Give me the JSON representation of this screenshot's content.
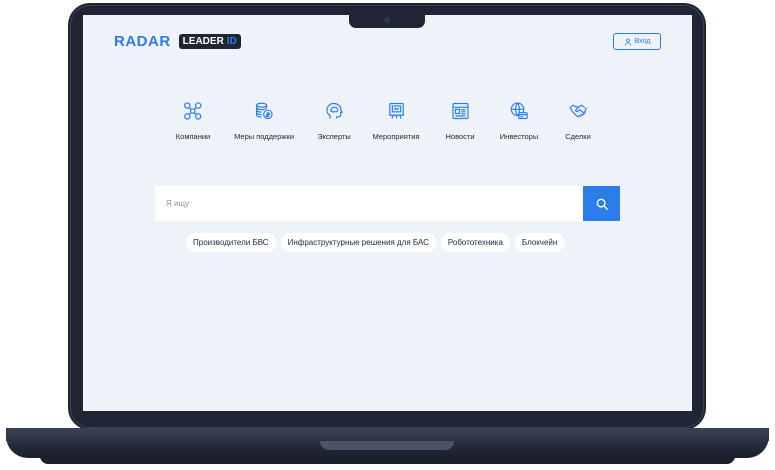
{
  "header": {
    "logo_text": "RADAR",
    "logo_badge_main": "LEADER",
    "logo_badge_accent": "ID",
    "login_label": "Вход"
  },
  "categories": [
    {
      "label": "Компании",
      "icon": "drone-icon"
    },
    {
      "label": "Меры поддержки",
      "icon": "coins-icon"
    },
    {
      "label": "Эксперты",
      "icon": "brain-head-icon"
    },
    {
      "label": "Мероприятия",
      "icon": "event-board-icon"
    },
    {
      "label": "Новости",
      "icon": "news-icon"
    },
    {
      "label": "Инвесторы",
      "icon": "globe-card-icon"
    },
    {
      "label": "Сделки",
      "icon": "handshake-icon"
    }
  ],
  "search": {
    "placeholder": "Я ищу",
    "value": ""
  },
  "tags": [
    {
      "label": "Производители БВС"
    },
    {
      "label": "Инфраструктурные решения для БАС"
    },
    {
      "label": "Робототехника"
    },
    {
      "label": "Блокчейн"
    }
  ],
  "colors": {
    "accent": "#2b7de9",
    "frame": "#1f2533",
    "screen_bg": "#eef3f9"
  }
}
